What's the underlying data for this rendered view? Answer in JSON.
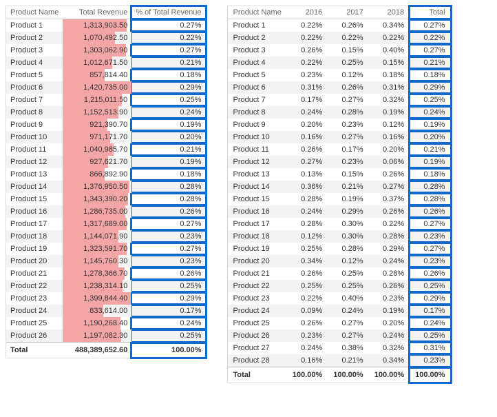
{
  "chart_data": [
    {
      "type": "table",
      "title": "",
      "columns": [
        "Product Name",
        "Total Revenue",
        "% of Total Revenue"
      ],
      "rows": [
        {
          "name": "Product 1",
          "rev": 1313903.5,
          "pct": 0.27
        },
        {
          "name": "Product 2",
          "rev": 1070492.5,
          "pct": 0.22
        },
        {
          "name": "Product 3",
          "rev": 1303062.9,
          "pct": 0.27
        },
        {
          "name": "Product 4",
          "rev": 1012671.5,
          "pct": 0.21
        },
        {
          "name": "Product 5",
          "rev": 857814.4,
          "pct": 0.18
        },
        {
          "name": "Product 6",
          "rev": 1420735.0,
          "pct": 0.29
        },
        {
          "name": "Product 7",
          "rev": 1215011.5,
          "pct": 0.25
        },
        {
          "name": "Product 8",
          "rev": 1152513.9,
          "pct": 0.24
        },
        {
          "name": "Product 9",
          "rev": 921390.7,
          "pct": 0.19
        },
        {
          "name": "Product 10",
          "rev": 971171.7,
          "pct": 0.2
        },
        {
          "name": "Product 11",
          "rev": 1040985.7,
          "pct": 0.21
        },
        {
          "name": "Product 12",
          "rev": 927621.7,
          "pct": 0.19
        },
        {
          "name": "Product 13",
          "rev": 866892.9,
          "pct": 0.18
        },
        {
          "name": "Product 14",
          "rev": 1376950.5,
          "pct": 0.28
        },
        {
          "name": "Product 15",
          "rev": 1343390.2,
          "pct": 0.28
        },
        {
          "name": "Product 16",
          "rev": 1286735.0,
          "pct": 0.26
        },
        {
          "name": "Product 17",
          "rev": 1317689.0,
          "pct": 0.27
        },
        {
          "name": "Product 18",
          "rev": 1144071.9,
          "pct": 0.23
        },
        {
          "name": "Product 19",
          "rev": 1323591.7,
          "pct": 0.27
        },
        {
          "name": "Product 20",
          "rev": 1145760.3,
          "pct": 0.23
        },
        {
          "name": "Product 21",
          "rev": 1278366.7,
          "pct": 0.26
        },
        {
          "name": "Product 22",
          "rev": 1238314.1,
          "pct": 0.25
        },
        {
          "name": "Product 23",
          "rev": 1399844.4,
          "pct": 0.29
        },
        {
          "name": "Product 24",
          "rev": 833614.0,
          "pct": 0.17
        },
        {
          "name": "Product 25",
          "rev": 1190268.4,
          "pct": 0.24
        },
        {
          "name": "Product 26",
          "rev": 1197082.3,
          "pct": 0.25
        }
      ],
      "bar_max": 1420735.0,
      "total_label": "Total",
      "total_rev": 488389652.6,
      "total_pct": 100.0
    },
    {
      "type": "table",
      "title": "",
      "columns": [
        "Product Name",
        "2016",
        "2017",
        "2018",
        "Total"
      ],
      "rows": [
        {
          "name": "Product 1",
          "y16": 0.22,
          "y17": 0.26,
          "y18": 0.34,
          "tot": 0.27
        },
        {
          "name": "Product 2",
          "y16": 0.22,
          "y17": 0.22,
          "y18": 0.22,
          "tot": 0.22
        },
        {
          "name": "Product 3",
          "y16": 0.26,
          "y17": 0.15,
          "y18": 0.4,
          "tot": 0.27
        },
        {
          "name": "Product 4",
          "y16": 0.22,
          "y17": 0.25,
          "y18": 0.15,
          "tot": 0.21
        },
        {
          "name": "Product 5",
          "y16": 0.23,
          "y17": 0.12,
          "y18": 0.18,
          "tot": 0.18
        },
        {
          "name": "Product 6",
          "y16": 0.31,
          "y17": 0.26,
          "y18": 0.31,
          "tot": 0.29
        },
        {
          "name": "Product 7",
          "y16": 0.17,
          "y17": 0.27,
          "y18": 0.32,
          "tot": 0.25
        },
        {
          "name": "Product 8",
          "y16": 0.24,
          "y17": 0.28,
          "y18": 0.19,
          "tot": 0.24
        },
        {
          "name": "Product 9",
          "y16": 0.2,
          "y17": 0.23,
          "y18": 0.12,
          "tot": 0.19
        },
        {
          "name": "Product 10",
          "y16": 0.16,
          "y17": 0.27,
          "y18": 0.16,
          "tot": 0.2
        },
        {
          "name": "Product 11",
          "y16": 0.26,
          "y17": 0.17,
          "y18": 0.2,
          "tot": 0.21
        },
        {
          "name": "Product 12",
          "y16": 0.27,
          "y17": 0.23,
          "y18": 0.06,
          "tot": 0.19
        },
        {
          "name": "Product 13",
          "y16": 0.13,
          "y17": 0.15,
          "y18": 0.26,
          "tot": 0.18
        },
        {
          "name": "Product 14",
          "y16": 0.36,
          "y17": 0.21,
          "y18": 0.27,
          "tot": 0.28
        },
        {
          "name": "Product 15",
          "y16": 0.28,
          "y17": 0.19,
          "y18": 0.37,
          "tot": 0.28
        },
        {
          "name": "Product 16",
          "y16": 0.24,
          "y17": 0.29,
          "y18": 0.26,
          "tot": 0.26
        },
        {
          "name": "Product 17",
          "y16": 0.28,
          "y17": 0.3,
          "y18": 0.22,
          "tot": 0.27
        },
        {
          "name": "Product 18",
          "y16": 0.12,
          "y17": 0.3,
          "y18": 0.28,
          "tot": 0.23
        },
        {
          "name": "Product 19",
          "y16": 0.25,
          "y17": 0.28,
          "y18": 0.29,
          "tot": 0.27
        },
        {
          "name": "Product 20",
          "y16": 0.34,
          "y17": 0.12,
          "y18": 0.24,
          "tot": 0.23
        },
        {
          "name": "Product 21",
          "y16": 0.26,
          "y17": 0.25,
          "y18": 0.28,
          "tot": 0.26
        },
        {
          "name": "Product 22",
          "y16": 0.25,
          "y17": 0.25,
          "y18": 0.26,
          "tot": 0.25
        },
        {
          "name": "Product 23",
          "y16": 0.22,
          "y17": 0.4,
          "y18": 0.23,
          "tot": 0.29
        },
        {
          "name": "Product 24",
          "y16": 0.09,
          "y17": 0.24,
          "y18": 0.19,
          "tot": 0.17
        },
        {
          "name": "Product 25",
          "y16": 0.26,
          "y17": 0.27,
          "y18": 0.2,
          "tot": 0.24
        },
        {
          "name": "Product 26",
          "y16": 0.23,
          "y17": 0.27,
          "y18": 0.24,
          "tot": 0.25
        },
        {
          "name": "Product 27",
          "y16": 0.24,
          "y17": 0.38,
          "y18": 0.32,
          "tot": 0.31
        },
        {
          "name": "Product 28",
          "y16": 0.16,
          "y17": 0.21,
          "y18": 0.34,
          "tot": 0.23
        }
      ],
      "total_label": "Total",
      "total_2016": 100.0,
      "total_2017": 100.0,
      "total_2018": 100.0,
      "total_tot": 100.0
    }
  ]
}
